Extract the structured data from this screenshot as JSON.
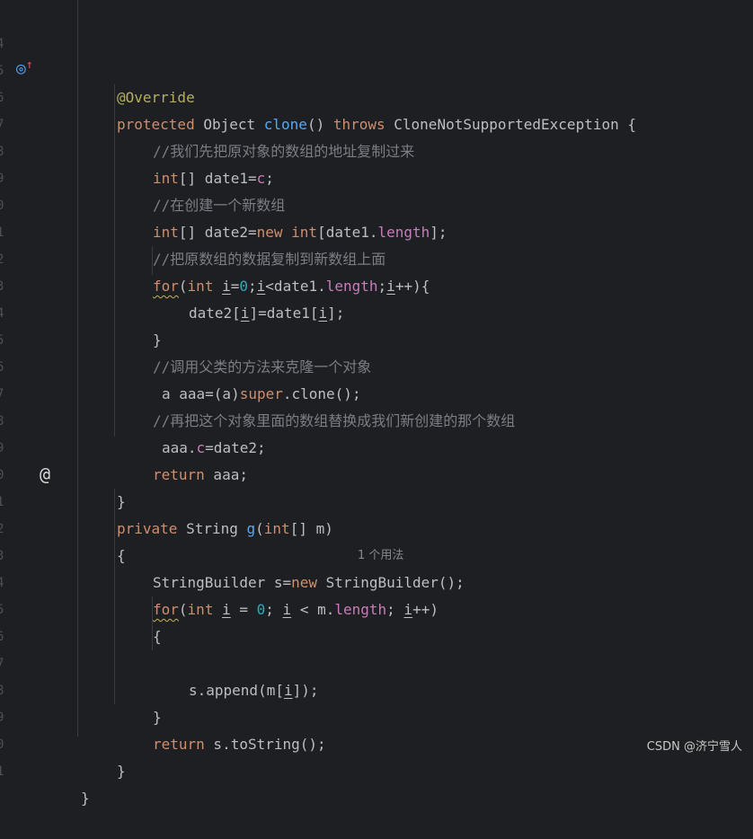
{
  "editor": {
    "line_numbers": [
      "4",
      "5",
      "6",
      "7",
      "8",
      "9",
      "0",
      "1",
      "2",
      "3",
      "4",
      "5",
      "6",
      "7",
      "8",
      "9",
      "0",
      "1",
      "2",
      "3",
      "4",
      "5",
      "6",
      "7",
      "8",
      "9",
      "0",
      "1"
    ],
    "comments": {
      "c1": "//我们先把原对象的数组的地址复制过来",
      "c2": "//在创建一个新数组",
      "c3": "//把原数组的数据复制到新数组上面",
      "c4": "//调用父类的方法来克隆一个对象",
      "c5": "//再把这个对象里面的数组替换成我们新创建的那个数组"
    },
    "inlay_hint": "1 个用法",
    "gutter": {
      "override_icon": "override-up-arrow-icon",
      "annotation_icon": "at-sign-icon"
    }
  },
  "watermark": "CSDN @济宁雪人"
}
